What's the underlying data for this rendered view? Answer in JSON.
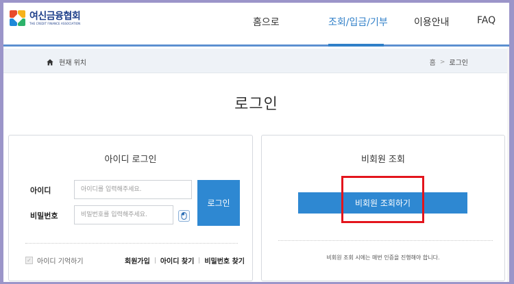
{
  "header": {
    "logo_name": "여신금융협회",
    "logo_sub": "THE CREDIT FINANCE ASSOCIATION",
    "nav": [
      {
        "label": "홈으로",
        "active": false
      },
      {
        "label": "조회/입금/기부",
        "active": true
      },
      {
        "label": "이용안내",
        "active": false
      },
      {
        "label": "FAQ",
        "active": false
      }
    ]
  },
  "breadcrumb": {
    "current_label": "현재 위치",
    "home": "홈",
    "separator": ">",
    "page": "로그인"
  },
  "page_title": "로그인",
  "id_login": {
    "title": "아이디 로그인",
    "id_label": "아이디",
    "id_placeholder": "아이디를 입력해주세요.",
    "pw_label": "비밀번호",
    "pw_placeholder": "비밀번호를 입력해주세요.",
    "login_button": "로그인",
    "remember_label": "아이디 기억하기",
    "links": [
      "회원가입",
      "아이디 찾기",
      "비밀번호 찾기"
    ]
  },
  "guest": {
    "title": "비회원 조회",
    "button": "비회원 조회하기",
    "note": "비회원 조회 시에는 매번 인증을 진행해야 합니다."
  },
  "colors": {
    "accent": "#2e88d2",
    "highlight": "#e3141c",
    "background": "#9b95c9"
  }
}
